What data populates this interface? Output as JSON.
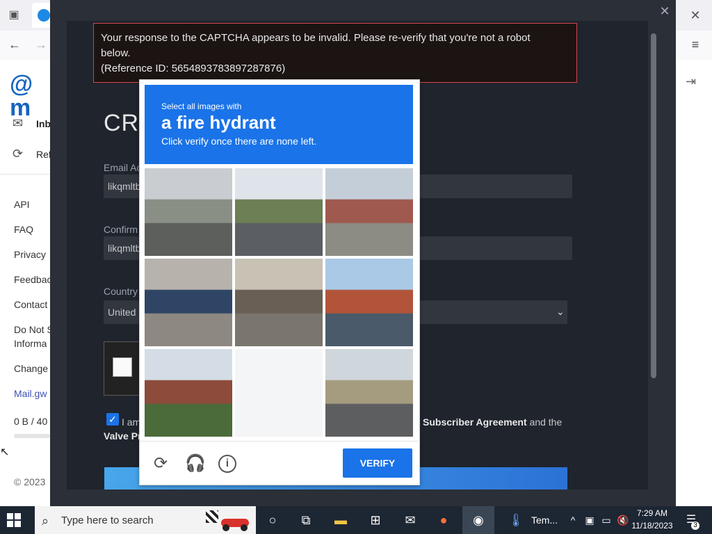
{
  "browser": {
    "close_icon": "close-icon",
    "menu_icon": "hamburger-icon"
  },
  "sidebar": {
    "logo": "@ m",
    "nav": [
      {
        "label": "Inb",
        "icon": "inbox-icon"
      },
      {
        "label": "Ref",
        "icon": "refresh-icon"
      }
    ],
    "links": [
      "API",
      "FAQ",
      "Privacy",
      "Feedbac",
      "Contact",
      "Do Not S",
      "Informa",
      "Change",
      "Mail.gw"
    ],
    "storage": "0 B  / 40",
    "copyright": "© 2023"
  },
  "error": {
    "line1": "Your response to the CAPTCHA appears to be invalid. Please re-verify that you're not a robot",
    "line2": "below.",
    "line3": "(Reference ID: 5654893783897287876)"
  },
  "form": {
    "title": "CRI",
    "email_label": "Email Ac",
    "email_value": "likqmltb",
    "confirm_label": "Confirm",
    "confirm_value": "likqmltb",
    "country_label": "Country",
    "country_value": "United",
    "agree_prefix": "I am",
    "agree_bold1": "Subscriber Agreement",
    "agree_mid": " and the",
    "agree_bold2": "Valve Pr"
  },
  "captcha": {
    "sub": "Select all images with",
    "target": "a fire hydrant",
    "hint": "Click verify once there are none left.",
    "verify": "VERIFY",
    "tiles": [
      {
        "desc": "road with parked cars",
        "colors": [
          "#c9ccd1",
          "#8a8f86",
          "#5d5f5d"
        ]
      },
      {
        "desc": "highway overpass",
        "colors": [
          "#dfe4ea",
          "#6d7f55",
          "#5b5e62"
        ]
      },
      {
        "desc": "house with awning",
        "colors": [
          "#c4ced8",
          "#a0594f",
          "#8c8c84"
        ]
      },
      {
        "desc": "motorcycle rider",
        "colors": [
          "#b7b2ac",
          "#2e4566",
          "#8e8882"
        ]
      },
      {
        "desc": "building with cone",
        "colors": [
          "#c8c2b5",
          "#6a5f55",
          "#7a756e"
        ]
      },
      {
        "desc": "marina with pole",
        "colors": [
          "#a9c9e6",
          "#b1543a",
          "#4a5a6a"
        ]
      },
      {
        "desc": "traffic light brick building",
        "colors": [
          "#d4dde6",
          "#8c4b3b",
          "#4b6b3a"
        ]
      },
      {
        "desc": "blank loading tile",
        "colors": [
          "#f4f5f6",
          "#f4f5f6",
          "#f4f5f6"
        ]
      },
      {
        "desc": "underpass road",
        "colors": [
          "#cfd6dc",
          "#a59b7f",
          "#5c5e60"
        ]
      }
    ]
  },
  "taskbar": {
    "search_placeholder": "Type here to search",
    "app_label": "Tem...",
    "time": "7:29 AM",
    "date": "11/18/2023",
    "notif_count": "3"
  }
}
